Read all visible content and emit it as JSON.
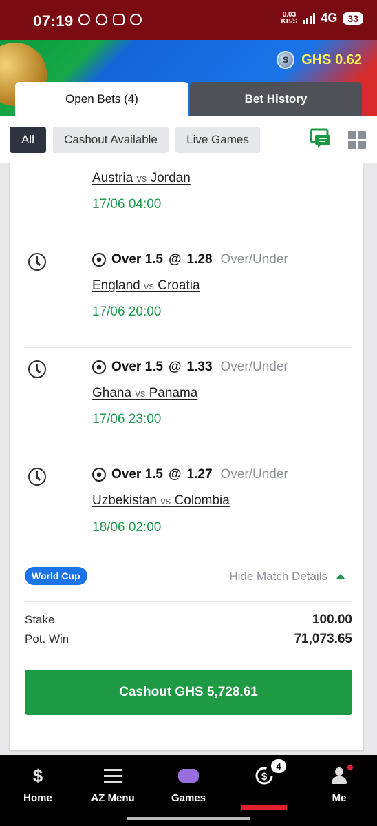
{
  "status_bar": {
    "time": "07:19",
    "net_speed_top": "0.03",
    "net_speed_bottom": "KB/S",
    "network": "4G",
    "battery": "33"
  },
  "header": {
    "balance": "GHS 0.62",
    "coin_icon": "coin-icon"
  },
  "tabs": [
    {
      "label": "Open Bets (4)",
      "active": true
    },
    {
      "label": "Bet History",
      "active": false
    }
  ],
  "filters": [
    {
      "label": "All",
      "active": true
    },
    {
      "label": "Cashout Available",
      "active": false
    },
    {
      "label": "Live Games",
      "active": false
    }
  ],
  "legs": [
    {
      "pick": "",
      "at": "",
      "odds": "",
      "market": "",
      "home": "Austria",
      "vs": "vs",
      "away": "Jordan",
      "kickoff": "17/06 04:00"
    },
    {
      "pick": "Over 1.5",
      "at": "@",
      "odds": "1.28",
      "market": "Over/Under",
      "home": "England",
      "vs": "vs",
      "away": "Croatia",
      "kickoff": "17/06 20:00"
    },
    {
      "pick": "Over 1.5",
      "at": "@",
      "odds": "1.33",
      "market": "Over/Under",
      "home": "Ghana",
      "vs": "vs",
      "away": "Panama",
      "kickoff": "17/06 23:00"
    },
    {
      "pick": "Over 1.5",
      "at": "@",
      "odds": "1.27",
      "market": "Over/Under",
      "home": "Uzbekistan",
      "vs": "vs",
      "away": "Colombia",
      "kickoff": "18/06 02:00"
    }
  ],
  "league_badge": "World Cup",
  "hide_details": "Hide Match Details",
  "summary": {
    "stake_label": "Stake",
    "stake_value": "100.00",
    "potwin_label": "Pot. Win",
    "potwin_value": "71,073.65"
  },
  "cashout_button": "Cashout GHS 5,728.61",
  "bottom_nav": [
    {
      "label": "Home",
      "icon": "sportybet-logo-icon"
    },
    {
      "label": "AZ Menu",
      "icon": "menu-icon"
    },
    {
      "label": "Games",
      "icon": "gamepad-icon"
    },
    {
      "label": "",
      "icon": "cashout-dollar-icon",
      "badge": "4",
      "active": true
    },
    {
      "label": "Me",
      "icon": "person-icon"
    }
  ],
  "colors": {
    "status_bar": "#7a0b12",
    "accent_green": "#1e9a45",
    "balance_yellow": "#fff45a",
    "badge_blue": "#1b75e8",
    "active_red": "#e0202a"
  }
}
